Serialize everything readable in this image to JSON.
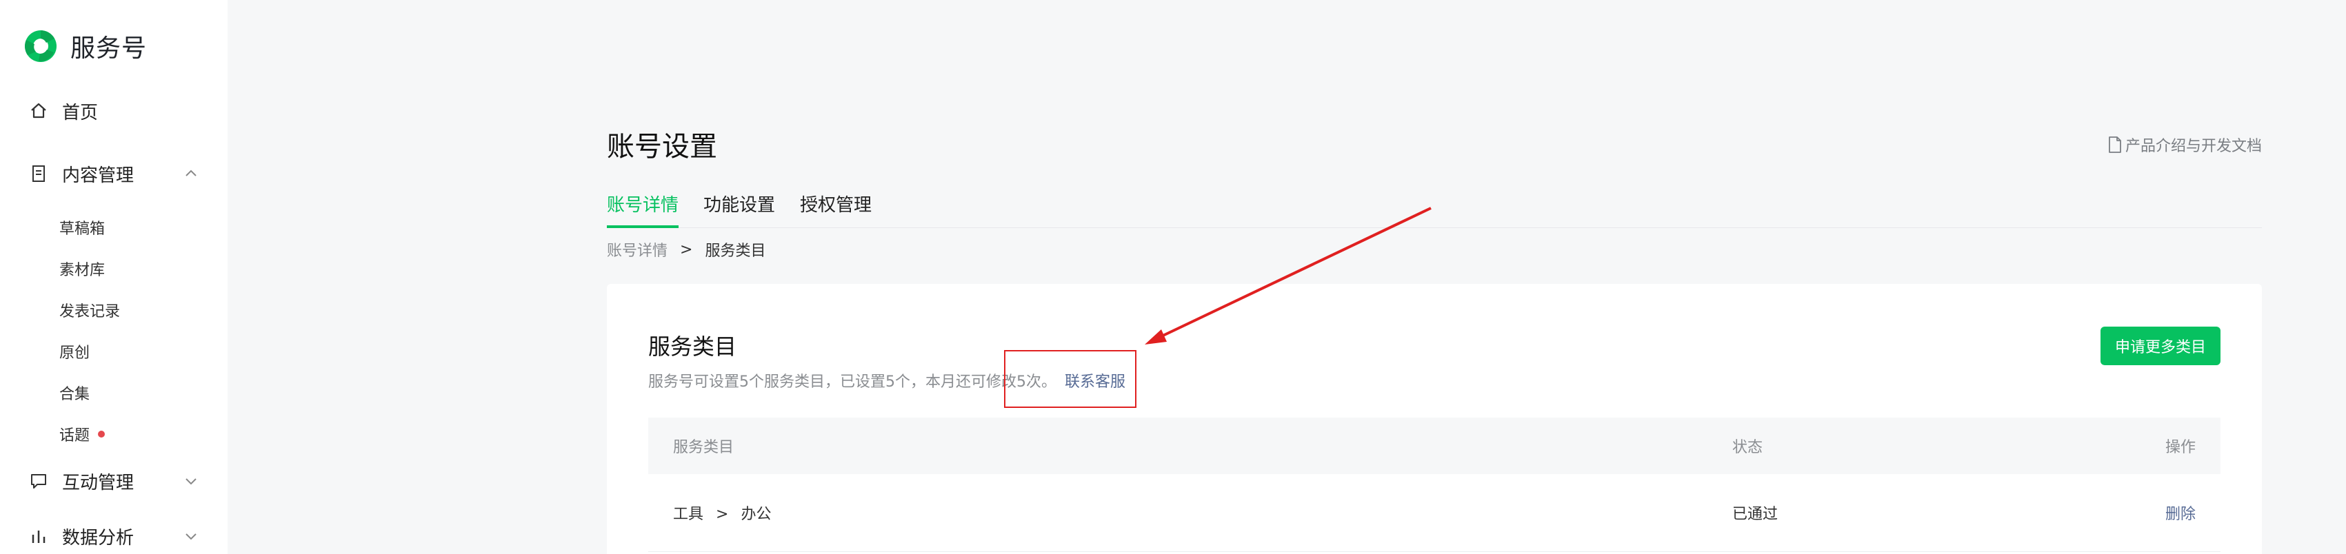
{
  "app": {
    "brand_title": "服务号",
    "brand_color": "#07c160"
  },
  "sidebar": {
    "items": [
      {
        "label": "首页",
        "icon": "home-icon"
      },
      {
        "label": "内容管理",
        "icon": "document-icon",
        "expanded": true,
        "children": [
          {
            "label": "草稿箱"
          },
          {
            "label": "素材库"
          },
          {
            "label": "发表记录"
          },
          {
            "label": "原创"
          },
          {
            "label": "合集"
          },
          {
            "label": "话题",
            "badge_dot": true
          }
        ]
      },
      {
        "label": "互动管理",
        "icon": "chat-icon",
        "expanded": false
      },
      {
        "label": "数据分析",
        "icon": "chart-icon",
        "expanded": false
      }
    ]
  },
  "header": {
    "title": "账号设置",
    "doc_link": "产品介绍与开发文档",
    "tabs": [
      {
        "label": "账号详情",
        "active": true
      },
      {
        "label": "功能设置",
        "active": false
      },
      {
        "label": "授权管理",
        "active": false
      }
    ],
    "breadcrumb": {
      "parent": "账号详情",
      "separator": ">",
      "current": "服务类目"
    }
  },
  "card": {
    "title": "服务类目",
    "description": "服务号可设置5个服务类目，已设置5个，本月还可修改5次。",
    "contact_link": "联系客服",
    "apply_button": "申请更多类目",
    "table": {
      "headers": {
        "category": "服务类目",
        "status": "状态",
        "action": "操作"
      },
      "rows": [
        {
          "category_parent": "工具",
          "separator": ">",
          "category_child": "办公",
          "status": "已通过",
          "action": "删除"
        }
      ]
    }
  },
  "colors": {
    "accent": "#07c160",
    "link": "#576b95",
    "annotation": "#e02020",
    "badge": "#e5484d"
  }
}
